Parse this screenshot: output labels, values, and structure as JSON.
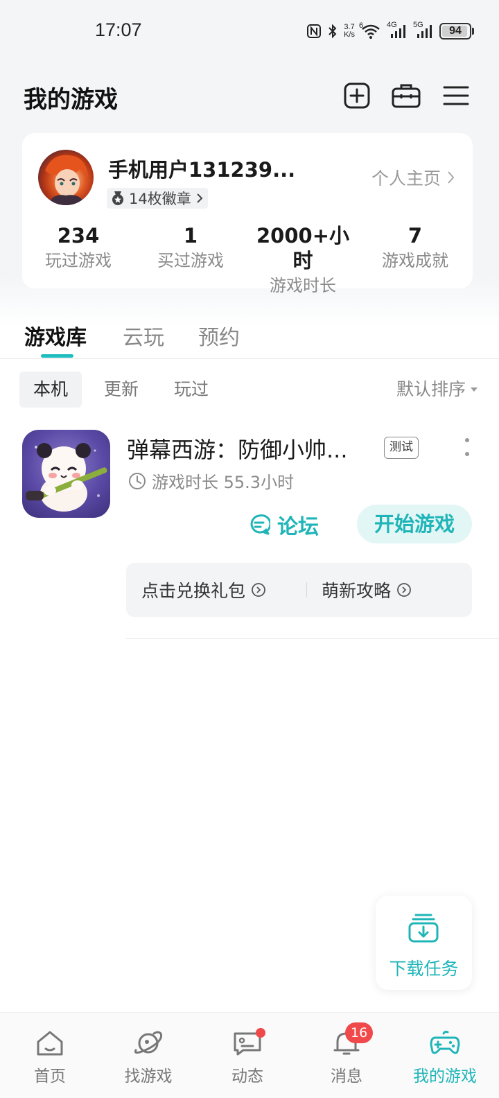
{
  "status_bar": {
    "time": "17:07",
    "net_speed_value": "3.7",
    "net_speed_unit": "K/s",
    "wifi_label": "6",
    "signal1_label": "4G",
    "signal2_label": "5G",
    "battery": "94",
    "battery_level": 0.94
  },
  "header": {
    "title": "我的游戏",
    "icons": [
      "add-square-icon",
      "toolbox-icon",
      "menu-icon"
    ]
  },
  "profile": {
    "username": "手机用户131239...",
    "badges": "14枚徽章",
    "homepage_link": "个人主页",
    "stats": [
      {
        "value": "234",
        "label": "玩过游戏"
      },
      {
        "value": "1",
        "label": "买过游戏"
      },
      {
        "value": "2000+小时",
        "label": "游戏时长"
      },
      {
        "value": "7",
        "label": "游戏成就"
      }
    ]
  },
  "tabs": [
    {
      "label": "游戏库",
      "active": true
    },
    {
      "label": "云玩",
      "active": false
    },
    {
      "label": "预约",
      "active": false
    }
  ],
  "filters": {
    "chips": [
      {
        "label": "本机",
        "active": true
      },
      {
        "label": "更新",
        "active": false
      },
      {
        "label": "玩过",
        "active": false
      }
    ],
    "sort_label": "默认排序"
  },
  "game": {
    "title": "弹幕西游：防御小帅...",
    "tag": "测试",
    "playtime": "游戏时长 55.3小时",
    "forum_label": "论坛",
    "start_label": "开始游戏",
    "gift_link": "点击兑换礼包",
    "guide_link": "萌新攻略"
  },
  "download_fab": {
    "label": "下载任务"
  },
  "bottom_nav": [
    {
      "label": "首页",
      "icon": "home-icon",
      "active": false
    },
    {
      "label": "找游戏",
      "icon": "planet-icon",
      "active": false
    },
    {
      "label": "动态",
      "icon": "chat-icon",
      "active": false,
      "dot": true
    },
    {
      "label": "消息",
      "icon": "bell-icon",
      "active": false,
      "badge": "16"
    },
    {
      "label": "我的游戏",
      "icon": "gamepad-icon",
      "active": true
    }
  ],
  "colors": {
    "accent": "#1fb5b8",
    "badge_red": "#f0494c",
    "background": "#f3f5f7"
  }
}
